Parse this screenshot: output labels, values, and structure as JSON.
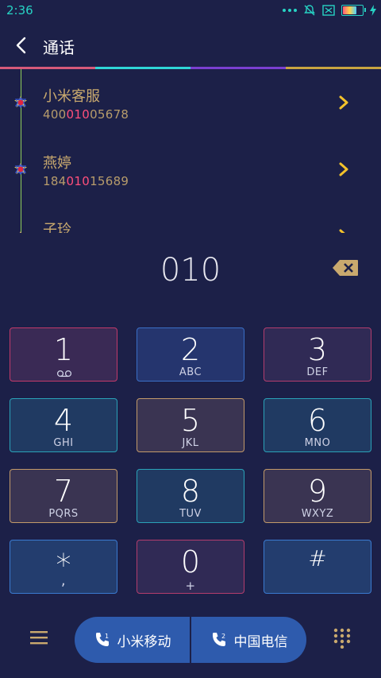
{
  "status_bar": {
    "time": "2:36",
    "accent": "#27d3c4"
  },
  "header": {
    "title": "通话"
  },
  "rainbow_colors": [
    "#d65a7a",
    "#2fd6d6",
    "#7a3fd0",
    "#c9a540"
  ],
  "calls": [
    {
      "name": "小米客服",
      "number_pre": "400",
      "number_match": "010",
      "number_post": "05678"
    },
    {
      "name": "燕婷",
      "number_pre": "184",
      "number_match": "010",
      "number_post": "15689"
    },
    {
      "name": "子玲",
      "number_pre": "",
      "number_match": "",
      "number_post": ""
    }
  ],
  "dialer": {
    "input": "010"
  },
  "keypad": [
    {
      "digit": "1",
      "letters": "ꝏ",
      "style": "k-red"
    },
    {
      "digit": "2",
      "letters": "ABC",
      "style": "k-blue"
    },
    {
      "digit": "3",
      "letters": "DEF",
      "style": "k-purple"
    },
    {
      "digit": "4",
      "letters": "GHI",
      "style": "k-teal"
    },
    {
      "digit": "5",
      "letters": "JKL",
      "style": "k-tan"
    },
    {
      "digit": "6",
      "letters": "MNO",
      "style": "k-teal"
    },
    {
      "digit": "7",
      "letters": "PQRS",
      "style": "k-tan"
    },
    {
      "digit": "8",
      "letters": "TUV",
      "style": "k-teal"
    },
    {
      "digit": "9",
      "letters": "WXYZ",
      "style": "k-tan"
    },
    {
      "digit": "*",
      "letters": ",",
      "style": "k-navy"
    },
    {
      "digit": "0",
      "letters": "+",
      "style": "k-purple"
    },
    {
      "digit": "#",
      "letters": "",
      "style": "k-navy"
    }
  ],
  "sim_buttons": [
    {
      "label": "小米移动",
      "sim": "1"
    },
    {
      "label": "中国电信",
      "sim": "2"
    }
  ],
  "icons": {
    "back": "chevron-left-icon",
    "delete": "backspace-icon",
    "menu": "hamburger-menu-icon",
    "dialpad": "dialpad-grid-icon",
    "phone": "phone-icon"
  }
}
